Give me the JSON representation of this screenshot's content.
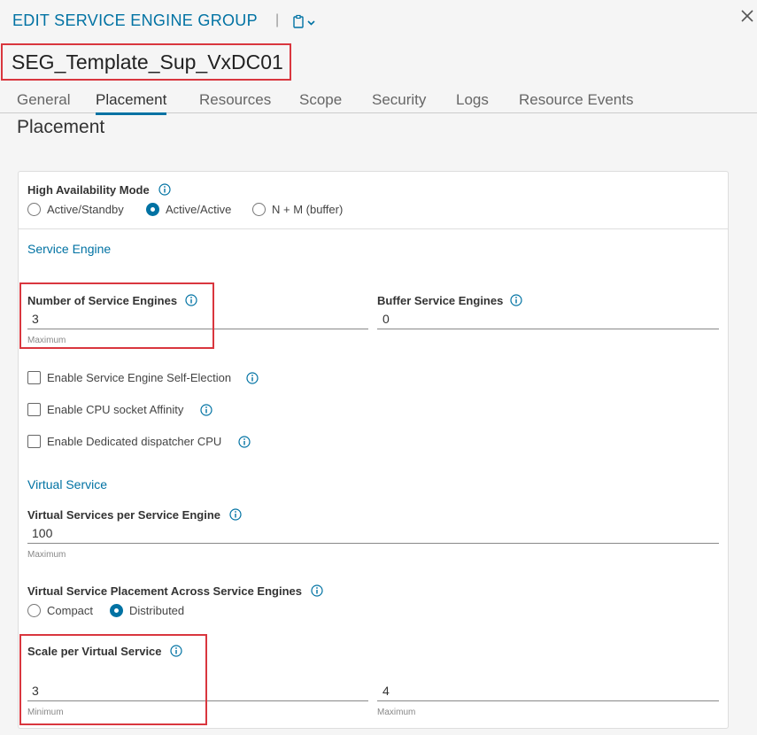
{
  "modal": {
    "title": "EDIT SERVICE ENGINE GROUP",
    "separator": "|",
    "name": "SEG_Template_Sup_VxDC01"
  },
  "tabs": [
    {
      "label": "General"
    },
    {
      "label": "Placement"
    },
    {
      "label": "Resources"
    },
    {
      "label": "Scope"
    },
    {
      "label": "Security"
    },
    {
      "label": "Logs"
    },
    {
      "label": "Resource Events"
    }
  ],
  "section_title": "Placement",
  "ha": {
    "label": "High Availability Mode",
    "options": [
      "Active/Standby",
      "Active/Active",
      "N + M (buffer)"
    ],
    "selected": "Active/Active"
  },
  "service_engine": {
    "heading": "Service Engine",
    "num_label": "Number of Service Engines",
    "num_value": "3",
    "num_hint": "Maximum",
    "buffer_label": "Buffer Service Engines",
    "buffer_value": "0",
    "checkboxes": [
      "Enable Service Engine Self-Election",
      "Enable CPU socket Affinity",
      "Enable Dedicated dispatcher CPU"
    ]
  },
  "virtual_service": {
    "heading": "Virtual Service",
    "vs_per_se_label": "Virtual Services per Service Engine",
    "vs_per_se_value": "100",
    "vs_per_se_hint": "Maximum",
    "placement_label": "Virtual Service Placement Across Service Engines",
    "placement_options": [
      "Compact",
      "Distributed"
    ],
    "placement_selected": "Distributed",
    "scale_label": "Scale per Virtual Service",
    "scale_min_value": "3",
    "scale_min_hint": "Minimum",
    "scale_max_value": "4",
    "scale_max_hint": "Maximum"
  },
  "colors": {
    "accent": "#0072a3",
    "highlight": "#d9363e"
  }
}
